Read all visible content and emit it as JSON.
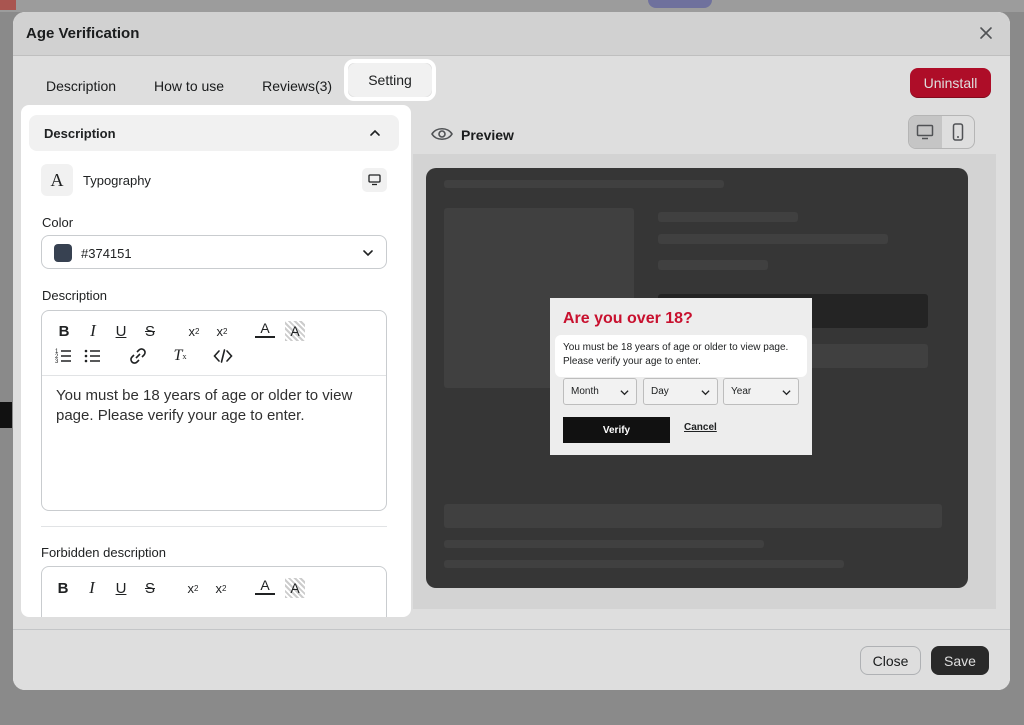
{
  "modal": {
    "title": "Age Verification",
    "close_icon": "close-icon"
  },
  "tabs": [
    {
      "label": "Description"
    },
    {
      "label": "How to use"
    },
    {
      "label": "Reviews(3)"
    },
    {
      "label": "Setting",
      "active": true
    }
  ],
  "header_actions": {
    "uninstall_label": "Uninstall"
  },
  "settings": {
    "section_title": "Description",
    "typography_label": "Typography",
    "color_label": "Color",
    "color_value": "#374151",
    "description_label": "Description",
    "description_text": "You must be 18 years of age or older to view page. Please verify your age to enter.",
    "forbidden_label": "Forbidden description"
  },
  "toolbar_icons": [
    "bold-icon",
    "italic-icon",
    "underline-icon",
    "strikethrough-icon",
    "subscript-icon",
    "superscript-icon",
    "text-color-icon",
    "highlight-icon",
    "ordered-list-icon",
    "bullet-list-icon",
    "link-icon",
    "clear-format-icon",
    "code-icon"
  ],
  "preview": {
    "title": "Preview",
    "popup": {
      "heading": "Are you over 18?",
      "text": "You must be 18 years of age or older to view page. Please verify your age to enter.",
      "month": "Month",
      "day": "Day",
      "year": "Year",
      "verify_label": "Verify",
      "cancel_label": "Cancel"
    }
  },
  "footer": {
    "close_label": "Close",
    "save_label": "Save"
  },
  "colors": {
    "accent_red": "#c8102e",
    "swatch": "#374151",
    "primary_dark": "#303030"
  }
}
